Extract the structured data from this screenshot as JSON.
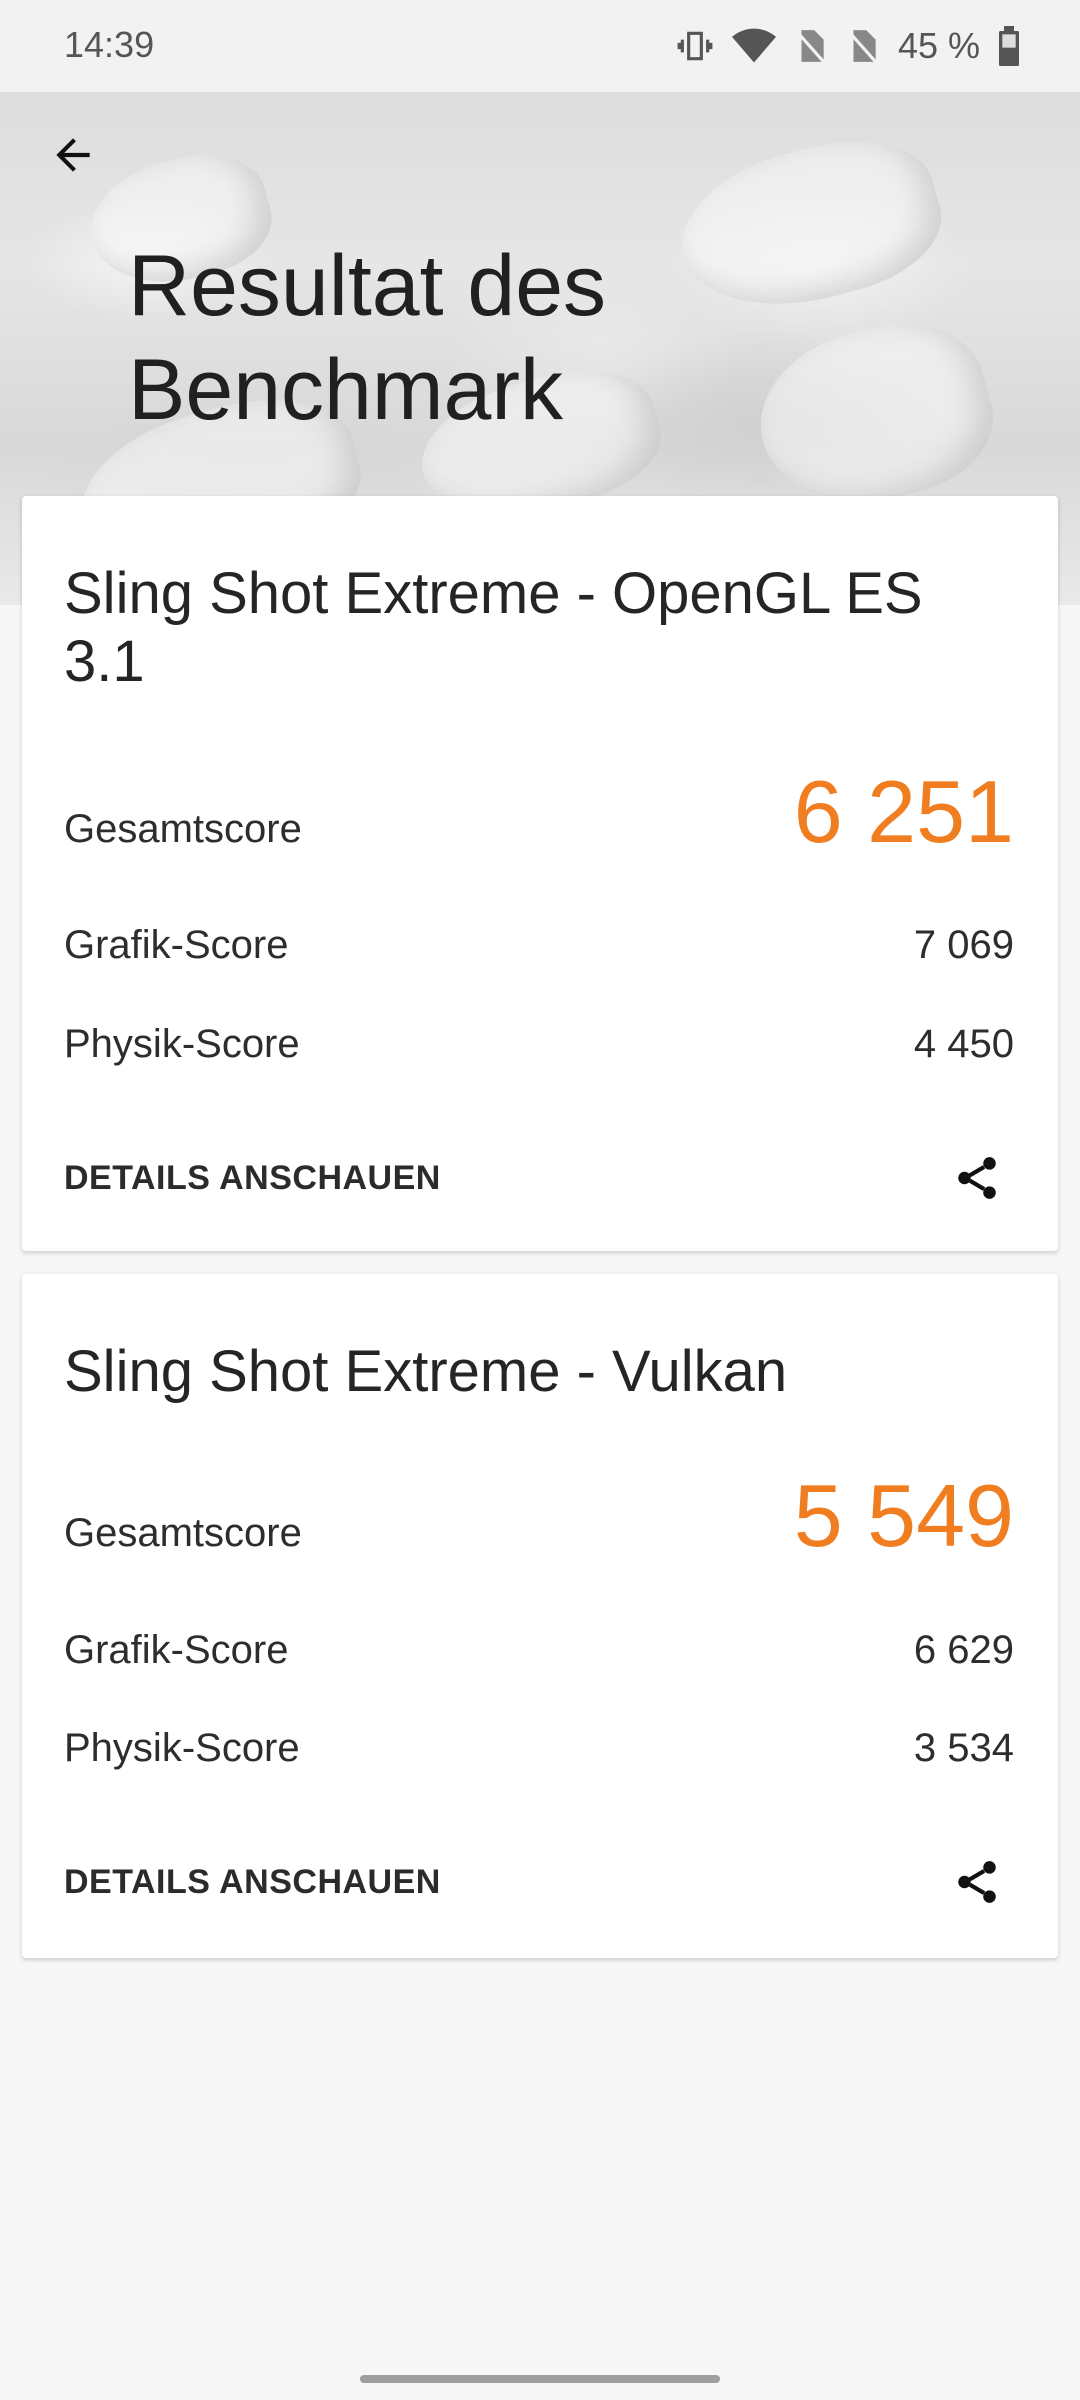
{
  "status_bar": {
    "time": "14:39",
    "battery_percent": "45 %",
    "icons": [
      "vibrate-icon",
      "wifi-icon",
      "no-sim-icon",
      "no-sim-icon",
      "battery-icon"
    ]
  },
  "header": {
    "back_icon": "arrow-left-icon",
    "title": "Resultat des Benchmark"
  },
  "results": [
    {
      "title": "Sling Shot Extreme - OpenGL ES 3.1",
      "total_label": "Gesamtscore",
      "total_value": "6 251",
      "graphics_label": "Grafik-Score",
      "graphics_value": "7 069",
      "physics_label": "Physik-Score",
      "physics_value": "4 450",
      "details_label": "DETAILS ANSCHAUEN",
      "share_icon": "share-icon"
    },
    {
      "title": "Sling Shot Extreme - Vulkan",
      "total_label": "Gesamtscore",
      "total_value": "5 549",
      "graphics_label": "Grafik-Score",
      "graphics_value": "6 629",
      "physics_label": "Physik-Score",
      "physics_value": "3 534",
      "details_label": "DETAILS ANSCHAUEN",
      "share_icon": "share-icon"
    }
  ],
  "colors": {
    "accent": "#f07d1f",
    "background": "#f7f7f7",
    "card": "#ffffff"
  }
}
